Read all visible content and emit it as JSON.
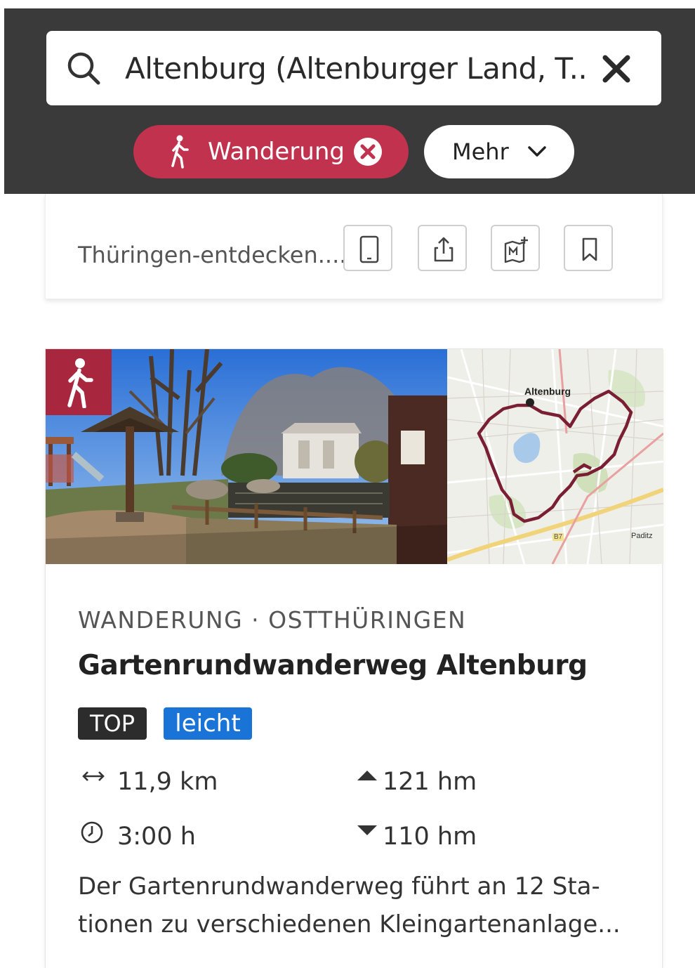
{
  "search": {
    "query": "Altenburg (Altenburger Land, T..."
  },
  "filters": {
    "active_chip": "Wanderung",
    "more_label": "Mehr"
  },
  "card_previous": {
    "source": "Thüringen-entdecken...."
  },
  "tour": {
    "category": "WANDERUNG · OSTTHÜRINGEN",
    "title": "Gartenrundwanderweg Altenburg",
    "badge_top": "TOP",
    "difficulty": "leicht",
    "distance": "11,9 km",
    "duration": "3:00 h",
    "ascent": "121 hm",
    "descent": "110 hm",
    "description": " Der Gartenrundwanderweg führt an 12 Sta-tionen zu verschiedenen Kleingartenanlage...",
    "map_labels": {
      "town": "Altenburg",
      "road": "B7",
      "place": "Paditz"
    }
  },
  "colors": {
    "header_bg": "#3a3a3a",
    "accent_red": "#c0324d",
    "badge_red": "#a8273f",
    "difficulty_blue": "#1a73d6"
  },
  "icons": {
    "search": "search-icon",
    "clear": "close-icon",
    "hike": "hiker-icon",
    "distance": "arrows-horizontal-icon",
    "duration": "clock-icon",
    "ascent": "triangle-up-icon",
    "descent": "triangle-down-icon"
  }
}
